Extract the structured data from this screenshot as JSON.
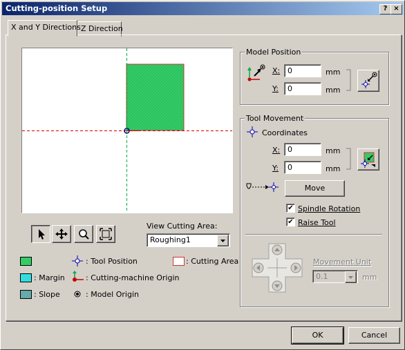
{
  "window": {
    "title": "Cutting-position Setup",
    "help_glyph": "?",
    "close_glyph": "×"
  },
  "tabs": [
    {
      "label": "X and Y Directions"
    },
    {
      "label": "Z Direction"
    }
  ],
  "view_cutting_area": {
    "label": "View Cutting Area:",
    "value": "Roughing1"
  },
  "legend": {
    "tool_position": ": Tool Position",
    "cutting_area": ": Cutting Area",
    "margin": ": Margin",
    "cutting_origin": ": Cutting-machine Origin",
    "slope": ": Slope",
    "model_origin": ": Model Origin"
  },
  "model_position": {
    "title": "Model Position",
    "x_label": "X:",
    "x_value": "0",
    "y_label": "Y:",
    "y_value": "0",
    "unit": "mm"
  },
  "tool_movement": {
    "title": "Tool Movement",
    "coordinates_label": "Coordinates",
    "x_label": "X:",
    "x_value": "0",
    "y_label": "Y:",
    "y_value": "0",
    "unit": "mm",
    "move_label": "Move",
    "spindle_rotation_label": "Spindle Rotation",
    "spindle_rotation_checked": true,
    "raise_tool_label": "Raise Tool",
    "raise_tool_checked": true,
    "movement_unit_label": "Movement Unit",
    "movement_unit_value": "0.1",
    "movement_unit_unit": "mm"
  },
  "buttons": {
    "ok": "OK",
    "cancel": "Cancel"
  },
  "colors": {
    "title_start": "#0a246a",
    "title_end": "#a6caf0",
    "area_fill": "#33cc66",
    "area_border": "#cc3333",
    "margin_fill": "#33dddd",
    "slope_fill": "#66aaaa",
    "crosshair": "#0000aa"
  }
}
